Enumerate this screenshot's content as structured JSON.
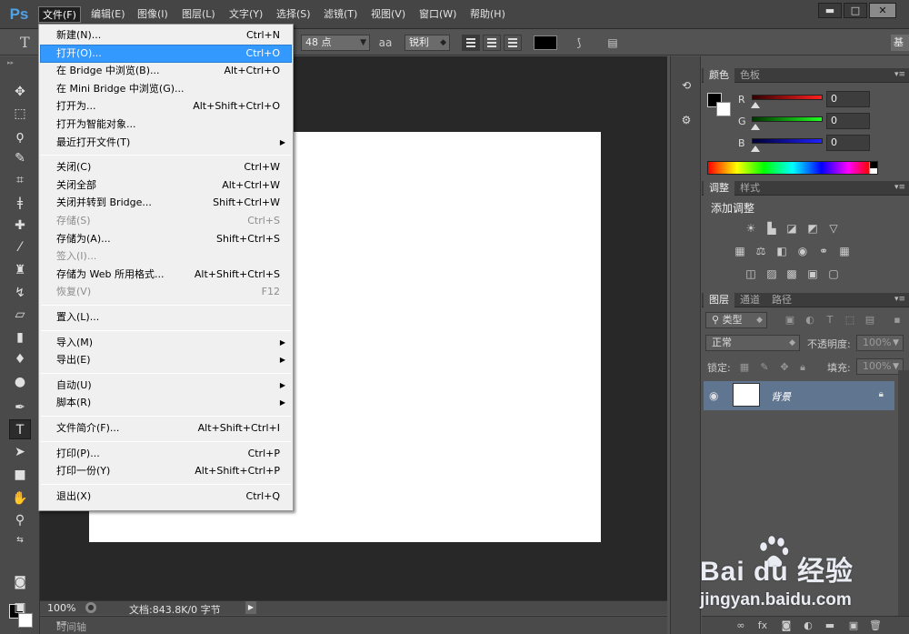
{
  "app": {
    "logo": "Ps"
  },
  "menubar": {
    "items": [
      "文件(F)",
      "编辑(E)",
      "图像(I)",
      "图层(L)",
      "文字(Y)",
      "选择(S)",
      "滤镜(T)",
      "视图(V)",
      "窗口(W)",
      "帮助(H)"
    ],
    "active": "文件(F)",
    "window_buttons": [
      "▬",
      "□",
      "✕"
    ]
  },
  "options_bar": {
    "font_size": "48 点",
    "aa_icon": "aa",
    "antialias": "锐利",
    "text_color": "#000000",
    "right_button": "基"
  },
  "file_menu": {
    "groups": [
      [
        {
          "label": "新建(N)...",
          "shortcut": "Ctrl+N"
        },
        {
          "label": "打开(O)...",
          "shortcut": "Ctrl+O",
          "highlighted": true
        },
        {
          "label": "在 Bridge 中浏览(B)...",
          "shortcut": "Alt+Ctrl+O"
        },
        {
          "label": "在 Mini Bridge 中浏览(G)...",
          "shortcut": ""
        },
        {
          "label": "打开为...",
          "shortcut": "Alt+Shift+Ctrl+O"
        },
        {
          "label": "打开为智能对象...",
          "shortcut": ""
        },
        {
          "label": "最近打开文件(T)",
          "shortcut": "",
          "submenu": true
        }
      ],
      [
        {
          "label": "关闭(C)",
          "shortcut": "Ctrl+W"
        },
        {
          "label": "关闭全部",
          "shortcut": "Alt+Ctrl+W"
        },
        {
          "label": "关闭并转到 Bridge...",
          "shortcut": "Shift+Ctrl+W"
        },
        {
          "label": "存储(S)",
          "shortcut": "Ctrl+S",
          "disabled": true
        },
        {
          "label": "存储为(A)...",
          "shortcut": "Shift+Ctrl+S"
        },
        {
          "label": "签入(I)...",
          "shortcut": "",
          "disabled": true
        },
        {
          "label": "存储为 Web 所用格式...",
          "shortcut": "Alt+Shift+Ctrl+S"
        },
        {
          "label": "恢复(V)",
          "shortcut": "F12",
          "disabled": true
        }
      ],
      [
        {
          "label": "置入(L)...",
          "shortcut": ""
        }
      ],
      [
        {
          "label": "导入(M)",
          "shortcut": "",
          "submenu": true
        },
        {
          "label": "导出(E)",
          "shortcut": "",
          "submenu": true
        }
      ],
      [
        {
          "label": "自动(U)",
          "shortcut": "",
          "submenu": true
        },
        {
          "label": "脚本(R)",
          "shortcut": "",
          "submenu": true
        }
      ],
      [
        {
          "label": "文件简介(F)...",
          "shortcut": "Alt+Shift+Ctrl+I"
        }
      ],
      [
        {
          "label": "打印(P)...",
          "shortcut": "Ctrl+P"
        },
        {
          "label": "打印一份(Y)",
          "shortcut": "Alt+Shift+Ctrl+P"
        }
      ],
      [
        {
          "label": "退出(X)",
          "shortcut": "Ctrl+Q"
        }
      ]
    ]
  },
  "status": {
    "zoom": "100%",
    "doc_info": "文档:843.8K/0 字节",
    "timeline_label": "时间轴"
  },
  "color_panel": {
    "tabs": [
      "颜色",
      "色板"
    ],
    "sliders": [
      {
        "label": "R",
        "value": "0",
        "color": "#d42020"
      },
      {
        "label": "G",
        "value": "0",
        "color": "#1fb51f"
      },
      {
        "label": "B",
        "value": "0",
        "color": "#2030d8"
      }
    ]
  },
  "adjustments_panel": {
    "tabs": [
      "调整",
      "样式"
    ],
    "title": "添加调整"
  },
  "layers_panel": {
    "tabs": [
      "图层",
      "通道",
      "路径"
    ],
    "filter_kind": "类型",
    "blend_mode": "正常",
    "opacity_label": "不透明度:",
    "opacity_value": "100%",
    "lock_label": "锁定:",
    "fill_label": "填充:",
    "fill_value": "100%",
    "layer_name": "背景"
  },
  "watermark": {
    "logo_text": "Bai du 经验",
    "url": "jingyan.baidu.com"
  }
}
